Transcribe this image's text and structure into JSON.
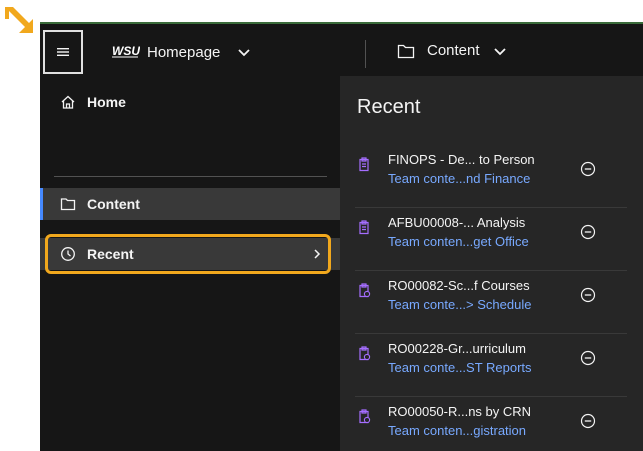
{
  "topbar": {
    "menu_icon": "hamburger-menu-icon",
    "logo_text": "WSU",
    "home_label": "Homepage",
    "content_label": "Content"
  },
  "sidebar": {
    "items": [
      {
        "label": "Home",
        "icon": "home-icon"
      },
      {
        "label": "Content",
        "icon": "folder-icon"
      },
      {
        "label": "Recent",
        "icon": "clock-icon"
      }
    ]
  },
  "panel": {
    "title": "Recent",
    "items": [
      {
        "title": "FINOPS - De... to Person",
        "path": "Team conte...nd Finance"
      },
      {
        "title": "AFBU00008-... Analysis",
        "path": "Team conten...get Office"
      },
      {
        "title": "RO00082-Sc...f Courses",
        "path": "Team conte...> Schedule"
      },
      {
        "title": "RO00228-Gr...urriculum",
        "path": "Team conte...ST Reports"
      },
      {
        "title": "RO00050-R...ns by CRN",
        "path": "Team conten...gistration"
      }
    ]
  },
  "colors": {
    "accent": "#4589ff",
    "highlight": "#f1a81d",
    "link": "#78a9ff",
    "report_icon": "#a56eff"
  }
}
